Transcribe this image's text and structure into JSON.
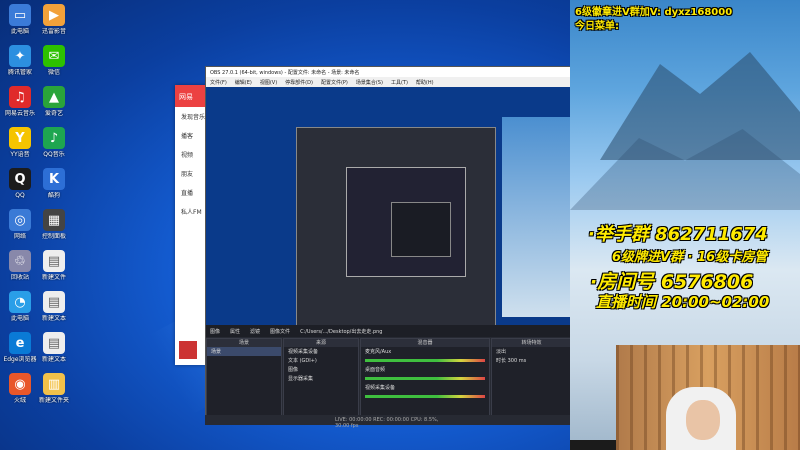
{
  "desktop_icons": [
    {
      "label": "此电脑",
      "color": "#3b7bd8",
      "glyph": "▭"
    },
    {
      "label": "迅雷影音",
      "color": "#f2a13a",
      "glyph": "▶"
    },
    {
      "label": "腾讯管家",
      "color": "#2c8fe0",
      "glyph": "✦"
    },
    {
      "label": "微信",
      "color": "#2dc100",
      "glyph": "✉"
    },
    {
      "label": "网易云音乐",
      "color": "#e02a2a",
      "glyph": "♫"
    },
    {
      "label": "爱奇艺",
      "color": "#2aa43a",
      "glyph": "▲"
    },
    {
      "label": "YY语音",
      "color": "#f5c400",
      "glyph": "Y"
    },
    {
      "label": "QQ音乐",
      "color": "#1ea650",
      "glyph": "♪"
    },
    {
      "label": "QQ",
      "color": "#1c1c1c",
      "glyph": "Q"
    },
    {
      "label": "酷狗",
      "color": "#2d6fd6",
      "glyph": "K"
    },
    {
      "label": "网络",
      "color": "#3a7ad6",
      "glyph": "◎"
    },
    {
      "label": "控制面板",
      "color": "#444",
      "glyph": "▦"
    },
    {
      "label": "回收站",
      "color": "#88a",
      "glyph": "♲"
    },
    {
      "label": "新建文件",
      "color": "#eee",
      "glyph": "▤"
    },
    {
      "label": "此电脑",
      "color": "#2a9ee8",
      "glyph": "◔"
    },
    {
      "label": "新建文本",
      "color": "#eee",
      "glyph": "▤"
    },
    {
      "label": "Edge浏览器",
      "color": "#0a7ad6",
      "glyph": "e"
    },
    {
      "label": "新建文本",
      "color": "#eee",
      "glyph": "▤"
    },
    {
      "label": "火绒",
      "color": "#e8572a",
      "glyph": "◉"
    },
    {
      "label": "新建文件夹",
      "color": "#f2c14a",
      "glyph": "▥"
    }
  ],
  "music_window": {
    "header": "网易",
    "items": [
      "发现音乐",
      "播客",
      "视频",
      "朋友",
      "直播",
      "私人FM"
    ]
  },
  "obs": {
    "title": "OBS 27.0.1 (64-bit, windows) - 配置文件: 未命名 - 场景: 未命名",
    "menu": [
      "文件(F)",
      "编辑(E)",
      "视图(V)",
      "停靠部件(D)",
      "配置文件(P)",
      "场景集合(S)",
      "工具(T)",
      "帮助(H)"
    ],
    "toolbar": [
      "图像",
      "属性",
      "滤镜",
      "图像文件",
      "C:/Users/.../Desktop/出去走走.png"
    ],
    "docks": {
      "scenes": {
        "title": "场景",
        "items": [
          "场景"
        ]
      },
      "sources": {
        "title": "来源",
        "items": [
          "视频采集设备",
          "文本 (GDI+)",
          "图像",
          "显示器采集"
        ]
      },
      "mixer": {
        "title": "混音器",
        "items": [
          "麦克风/Aux",
          "桌面音频",
          "视频采集设备"
        ]
      },
      "transitions": {
        "title": "转场特效",
        "items": [
          "淡出",
          "时长 300 ms"
        ]
      }
    },
    "status": "LIVE: 00:00:00   REC: 00:00:00   CPU: 8.5%, 30.00 fps"
  },
  "stream_panel": {
    "top_line": "6级徽章进V群加V: dyxz168000",
    "menu_line": "今日菜单:",
    "group_line": "·举手群 862711674",
    "vip_line": "6级牌进V群 · 16级卡房管",
    "room_line": "·房间号 6576806",
    "time_line": "直播时间 20:00~02:00"
  }
}
